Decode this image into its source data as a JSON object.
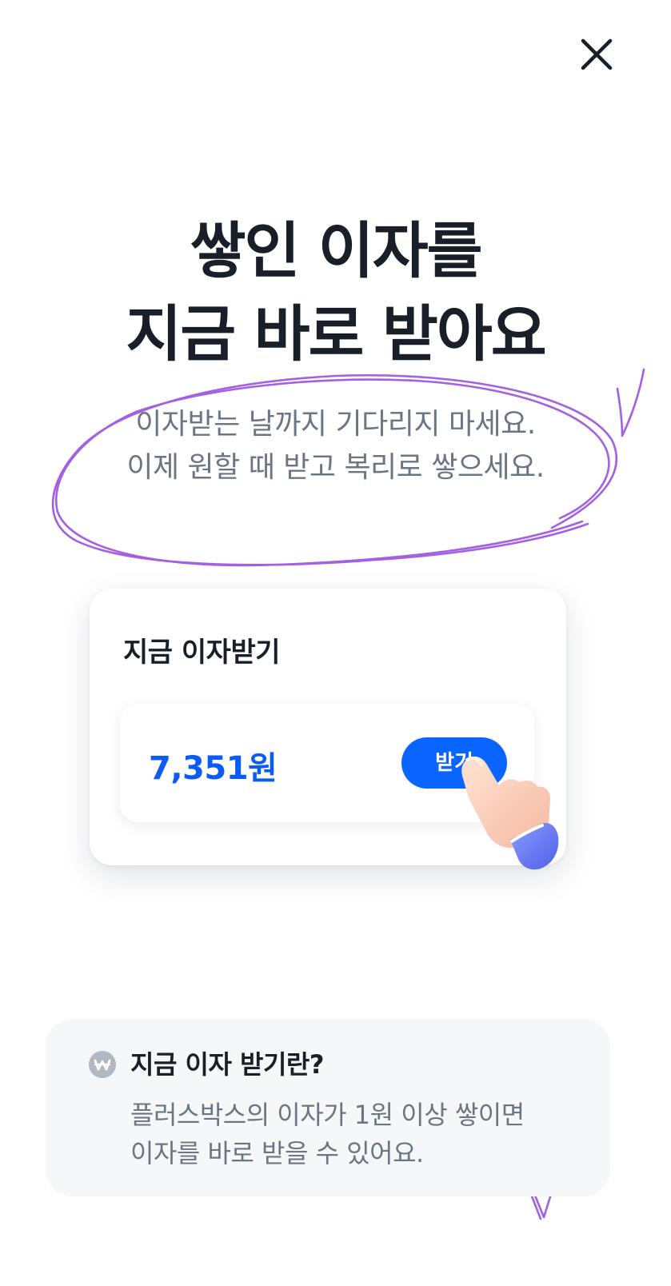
{
  "close": {
    "icon": "close-icon"
  },
  "headline": {
    "line1": "쌓인 이자를",
    "line2": "지금 바로 받아요"
  },
  "subtext": {
    "line1": "이자받는 날까지 기다리지 마세요.",
    "line2": "이제 원할 때 받고 복리로 쌓으세요."
  },
  "card": {
    "title": "지금 이자받기",
    "amount": "7,351원",
    "button_label": "받기"
  },
  "info": {
    "icon": "won-icon",
    "title": "지금 이자 받기란?",
    "line1": "플러스박스의 이자가 1원 이상 쌓이면",
    "line2": "이자를 바로 받을 수 있어요."
  },
  "colors": {
    "accent": "#0a64ff",
    "amount": "#0b5bf5",
    "annotation": "#9b4fe0",
    "text_primary": "#191f28",
    "text_secondary": "#6b7684"
  }
}
